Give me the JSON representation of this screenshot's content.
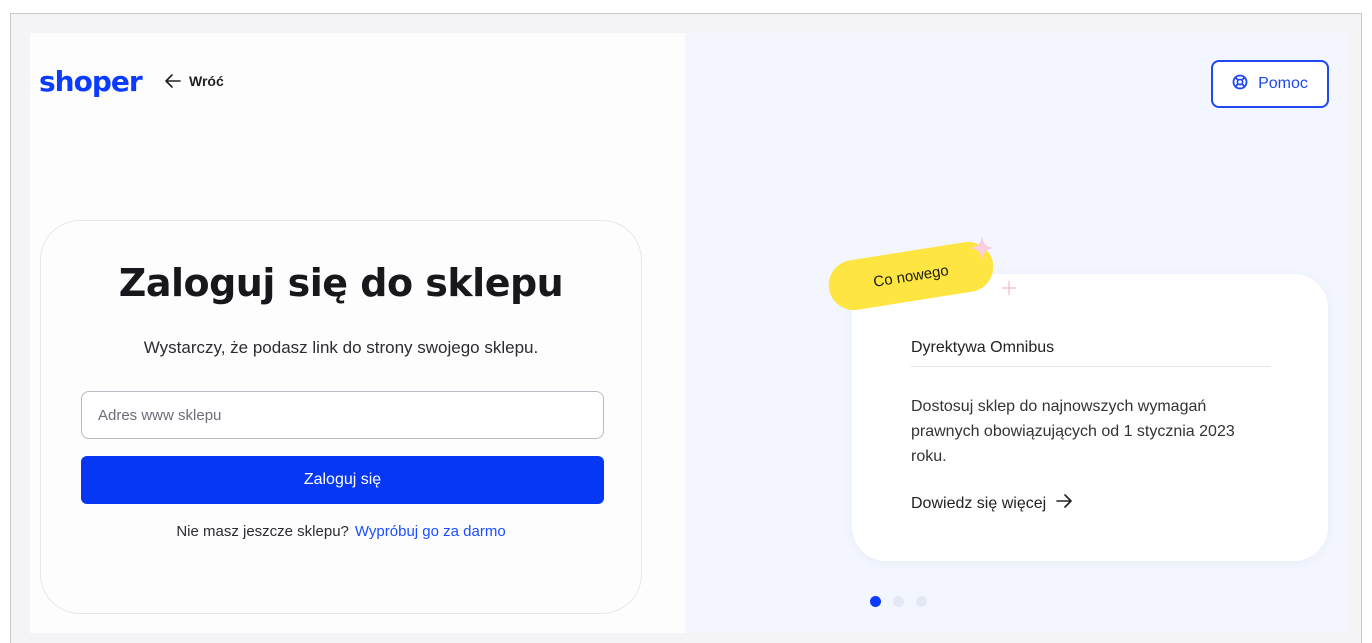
{
  "header": {
    "logo": "shoper",
    "back_label": "Wróć"
  },
  "login": {
    "title": "Zaloguj się do sklepu",
    "subtitle": "Wystarczy, że podasz link do strony swojego sklepu.",
    "input_placeholder": "Adres www sklepu",
    "input_value": "",
    "submit_label": "Zaloguj się",
    "signup_prompt": "Nie masz jeszcze sklepu?",
    "signup_link": "Wypróbuj go za darmo"
  },
  "help": {
    "label": "Pomoc",
    "icon": "lifebuoy-icon"
  },
  "news": {
    "badge": "Co nowego",
    "title": "Dyrektywa Omnibus",
    "text": "Dostosuj sklep do najnowszych wymagań prawnych obowiązujących od 1 stycznia 2023 roku.",
    "link": "Dowiedz się więcej",
    "slides_total": 3,
    "active_slide": 1
  },
  "colors": {
    "brand": "#0a3bff",
    "primary_button": "#0637f5",
    "badge": "#ffe541",
    "right_panel_bg": "#f3f6fe"
  }
}
